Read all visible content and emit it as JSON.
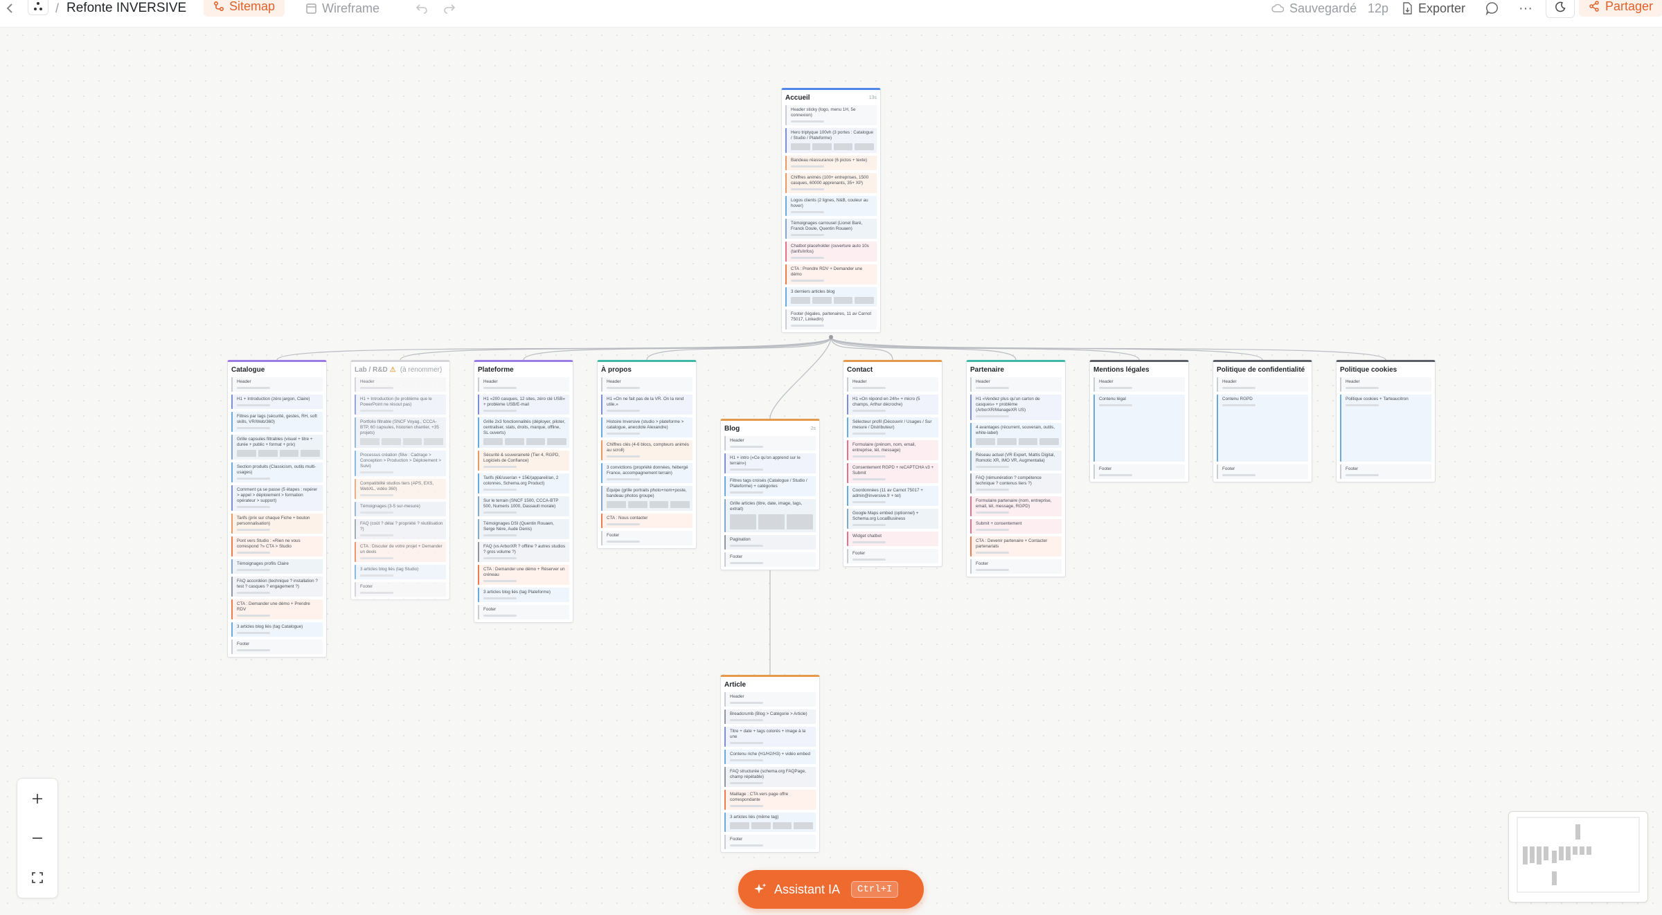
{
  "topbar": {
    "project_title": "Refonte INVERSIVE",
    "separator": "/",
    "tab_sitemap": "Sitemap",
    "tab_wireframe": "Wireframe",
    "saved_status": "Sauvegardé",
    "page_count": "12p",
    "export_label": "Exporter",
    "share_label": "Partager",
    "accent": "#ee6a2f"
  },
  "assistant": {
    "label": "Assistant IA",
    "shortcut": "Ctrl+I"
  },
  "pages": [
    {
      "name": "accueil",
      "title": "Accueil",
      "badge": "13s",
      "accent": "#4f86e8",
      "sections": [
        {
          "t": "Header sticky (logo, menu 1H, 5e connexion)",
          "k": "t-head"
        },
        {
          "t": "Hero triptyque 100vh (3 portes : Catalogue / Studio / Plateforme)",
          "k": "t-hero",
          "i": 1
        },
        {
          "t": "Bandeau réassurance (6 pictos + texte)",
          "k": "t-proof"
        },
        {
          "t": "Chiffres animés (100+ entreprises, 1500 casques, 60000 apprenants, 35+ XP)",
          "k": "t-proof"
        },
        {
          "t": "Logos clients (2 lignes, N&B, couleur au hover)",
          "k": "t-feat"
        },
        {
          "t": "Témoignages carrousel (Lionel Baré, Franck Doule, Quentin Rouaen)",
          "k": "t-media"
        },
        {
          "t": "Chatbot placeholder (ouverture auto 10s (tarifs/infos)",
          "k": "t-form"
        },
        {
          "t": "CTA : Prendre RDV + Demander une démo",
          "k": "t-cta"
        },
        {
          "t": "3 derniers articles blog",
          "k": "t-feat",
          "i": 1
        },
        {
          "t": "Footer (légales, partenaires, 11 av Carnot 75017, LinkedIn)",
          "k": "t-head"
        }
      ]
    },
    {
      "name": "catalogue",
      "title": "Catalogue",
      "accent": "#9b7be3",
      "sections": [
        {
          "t": "Header",
          "k": "t-head"
        },
        {
          "t": "H1 + Introduction (zéro jargon, Claire)",
          "k": "t-hero"
        },
        {
          "t": "Filtres par tags (sécurité, gestes, RH, soft skills, VR/Web/360)",
          "k": "t-feat"
        },
        {
          "t": "Grille capsules filtrables (visuel + titre + durée + public + format + prix)",
          "k": "t-media",
          "i": 1
        },
        {
          "t": "Section produits (Classicism, outils multi-usages)",
          "k": "t-feat"
        },
        {
          "t": "Comment ça se passe (5 étapes : repérer > appel > déploiement > formation opérateur > support)",
          "k": "t-hero"
        },
        {
          "t": "Tarifs (prix sur chaque Fiche + bouton personnalisation)",
          "k": "t-proof"
        },
        {
          "t": "Pont vers Studio : «Rien ne vous correspond ?» CTA > Studio",
          "k": "t-cta"
        },
        {
          "t": "Témoignages profils Claire",
          "k": "t-media"
        },
        {
          "t": "FAQ accordéon (technique ? installation ? test ? casques ? engagement ?)",
          "k": "t-faq"
        },
        {
          "t": "CTA : Demander une démo + Prendre RDV",
          "k": "t-cta"
        },
        {
          "t": "3 articles blog liés (tag Catalogue)",
          "k": "t-feat"
        },
        {
          "t": "Footer",
          "k": "t-head"
        }
      ]
    },
    {
      "name": "lab",
      "title": "Lab / R&D",
      "title_note": "(à renommer)",
      "accent": "#c9ccd1",
      "dim": true,
      "sections": [
        {
          "t": "Header",
          "k": "t-head"
        },
        {
          "t": "H1 + Introduction (le problème que le PowerPoint ne résout pas)",
          "k": "t-hero"
        },
        {
          "t": "Portfolio filtrable (SNCF Voyag., CCCA-BTP, 60 capsules, historien chantier, +35 projets)",
          "k": "t-media",
          "i": 1
        },
        {
          "t": "Processus création (filiw : Cadrage > Conception > Production > Déploiement > Suivi)",
          "k": "t-feat"
        },
        {
          "t": "Compatibilité studios tiers (APS, EXS, WebXL, vidéo 360)",
          "k": "t-proof"
        },
        {
          "t": "Témoignages (3-5 sur-mesure)",
          "k": "t-media"
        },
        {
          "t": "FAQ (coût ? délai ? propriété ? réutilisation ?)",
          "k": "t-faq"
        },
        {
          "t": "CTA : Discuter de votre projet + Demander un devis",
          "k": "t-cta"
        },
        {
          "t": "3 articles blog liés (tag Studio)",
          "k": "t-feat"
        },
        {
          "t": "Footer",
          "k": "t-head"
        }
      ]
    },
    {
      "name": "plateforme",
      "title": "Plateforme",
      "accent": "#9b7be3",
      "sections": [
        {
          "t": "Header",
          "k": "t-head"
        },
        {
          "t": "H1 «200 casques, 12 sites, zéro clé USB» + problème USB/E-mail",
          "k": "t-hero"
        },
        {
          "t": "Grille 2x3 fonctionnalités (déployer, piloter, centraliser, stats, droits, marque, offline, SL ouverts)",
          "k": "t-feat",
          "i": 1
        },
        {
          "t": "Sécurité & souveraineté (Tier 4, RGPD, Logiciels de Confiance)",
          "k": "t-proof"
        },
        {
          "t": "Tarifs (€€/user/an + 15€/(appareil/an, 2 colonnes, Schema.org Product)",
          "k": "t-feat"
        },
        {
          "t": "Sur le terrain (SNCF 1500, CCCA-BTP 500, Numeris 1000, Dassault morale)",
          "k": "t-media"
        },
        {
          "t": "Témoignages DSI (Quentin Rouaen, Serge Nère, Aude Denis)",
          "k": "t-media"
        },
        {
          "t": "FAQ (vs ArborXR ? offline ? autres studios ? gros volume ?)",
          "k": "t-faq"
        },
        {
          "t": "CTA : Demander une démo + Réserver un créneau",
          "k": "t-cta"
        },
        {
          "t": "3 articles blog liés (tag Plateforme)",
          "k": "t-feat"
        },
        {
          "t": "Footer",
          "k": "t-head"
        }
      ]
    },
    {
      "name": "apropos",
      "title": "À propos",
      "accent": "#3fb8a8",
      "sections": [
        {
          "t": "Header",
          "k": "t-head"
        },
        {
          "t": "H1 «On ne fait pas de la VR. On la rend utile.»",
          "k": "t-hero"
        },
        {
          "t": "Histoire Inversive (studio > plateforme > catalogue, anecdote Alexandre)",
          "k": "t-feat"
        },
        {
          "t": "Chiffres clés (4-6 blocs, compteurs animés au scroll)",
          "k": "t-proof"
        },
        {
          "t": "3 convictions (propriété données, hébergé France, accompagnement terrain)",
          "k": "t-feat"
        },
        {
          "t": "Équipe (grille portraits photo+nom+poste, bandeau photos groupe)",
          "k": "t-media",
          "i": 1
        },
        {
          "t": "CTA : Nous contacter",
          "k": "t-cta"
        },
        {
          "t": "Footer",
          "k": "t-head"
        }
      ]
    },
    {
      "name": "blog",
      "title": "Blog",
      "badge": "2s",
      "accent": "#e59a4b",
      "sections": [
        {
          "t": "Header",
          "k": "t-head"
        },
        {
          "t": "H1 + intro («Ce qu'on apprend sur le terrain»)",
          "k": "t-hero"
        },
        {
          "t": "Filtres tags croisés (Catalogue / Studio / Plateforme) + catégories",
          "k": "t-feat"
        },
        {
          "t": "Grille articles (titre, date, image, tags, extrait)",
          "k": "t-media",
          "i": 2
        },
        {
          "t": "Pagination",
          "k": "t-faq"
        },
        {
          "t": "Footer",
          "k": "t-head"
        }
      ]
    },
    {
      "name": "contact",
      "title": "Contact",
      "accent": "#e59a4b",
      "sections": [
        {
          "t": "Header",
          "k": "t-head"
        },
        {
          "t": "H1 «On répond en 24h» + micro (5 champs, Arthur décroche)",
          "k": "t-hero"
        },
        {
          "t": "Sélecteur profil (Découvrir / Usages / Sur mesure / Distributeur)",
          "k": "t-feat"
        },
        {
          "t": "Formulaire (prénom, nom, email, entreprise, tél, message)",
          "k": "t-form"
        },
        {
          "t": "Consentement RGPD + reCAPTCHA v3 + Submit",
          "k": "t-form"
        },
        {
          "t": "Coordonnées (11 av Carnot 75017 + admin@inversive.fr + tel)",
          "k": "t-feat"
        },
        {
          "t": "Google Maps embed (optionnel) + Schema.org LocalBusiness",
          "k": "t-media"
        },
        {
          "t": "Widget chatbot",
          "k": "t-form"
        },
        {
          "t": "Footer",
          "k": "t-head"
        }
      ]
    },
    {
      "name": "partenaire",
      "title": "Partenaire",
      "accent": "#3fb8a8",
      "sections": [
        {
          "t": "Header",
          "k": "t-head"
        },
        {
          "t": "H1 «Vendez plus qu'un carton de casques» + problème (ArborXR/ManageXR US)",
          "k": "t-hero"
        },
        {
          "t": "4 avantages (récurrent, souverain, outils, white-label)",
          "k": "t-feat",
          "i": 1
        },
        {
          "t": "Réseau actuel (VR Expert, Mattis Digital, Romotic XR, IMO VR, Augmentalia)",
          "k": "t-media"
        },
        {
          "t": "FAQ (rémunération ? compétence technique ? contenus tiers ?)",
          "k": "t-faq"
        },
        {
          "t": "Formulaire partenaire (nom, entreprise, email, tél, message, RGPD)",
          "k": "t-form"
        },
        {
          "t": "Submit + consentement",
          "k": "t-form"
        },
        {
          "t": "CTA : Devenir partenaire + Contacter partenariats",
          "k": "t-cta"
        },
        {
          "t": "Footer",
          "k": "t-head"
        }
      ]
    },
    {
      "name": "mentions",
      "title": "Mentions légales",
      "accent": "#5a5e66",
      "sections": [
        {
          "t": "Header",
          "k": "t-head"
        },
        {
          "t": "Contenu légal",
          "k": "t-feat",
          "tall": 1
        },
        {
          "t": "Footer",
          "k": "t-head"
        }
      ]
    },
    {
      "name": "confidentialite",
      "title": "Politique de confidentialité",
      "accent": "#5a5e66",
      "sections": [
        {
          "t": "Header",
          "k": "t-head"
        },
        {
          "t": "Contenu RGPD",
          "k": "t-feat",
          "tall": 1
        },
        {
          "t": "Footer",
          "k": "t-head"
        }
      ]
    },
    {
      "name": "cookies",
      "title": "Politique cookies",
      "accent": "#5a5e66",
      "sections": [
        {
          "t": "Header",
          "k": "t-head"
        },
        {
          "t": "Politique cookies + Tarteaucitron",
          "k": "t-feat",
          "tall": 1
        },
        {
          "t": "Footer",
          "k": "t-head"
        }
      ]
    },
    {
      "name": "article",
      "title": "Article",
      "accent": "#e59a4b",
      "sections": [
        {
          "t": "Header",
          "k": "t-head"
        },
        {
          "t": "Breadcrumb (Blog > Catégorie > Article)",
          "k": "t-faq"
        },
        {
          "t": "Titre + date + tags colorés + image à la une",
          "k": "t-hero"
        },
        {
          "t": "Contenu riche (H1/H2/H3) + vidéo embed",
          "k": "t-feat"
        },
        {
          "t": "FAQ structurée (schema.org FAQPage, champ répétable)",
          "k": "t-faq"
        },
        {
          "t": "Maillage : CTA vers page offre correspondante",
          "k": "t-cta"
        },
        {
          "t": "3 articles liés (même tag)",
          "k": "t-feat",
          "i": 1
        },
        {
          "t": "Footer",
          "k": "t-head"
        }
      ]
    }
  ]
}
